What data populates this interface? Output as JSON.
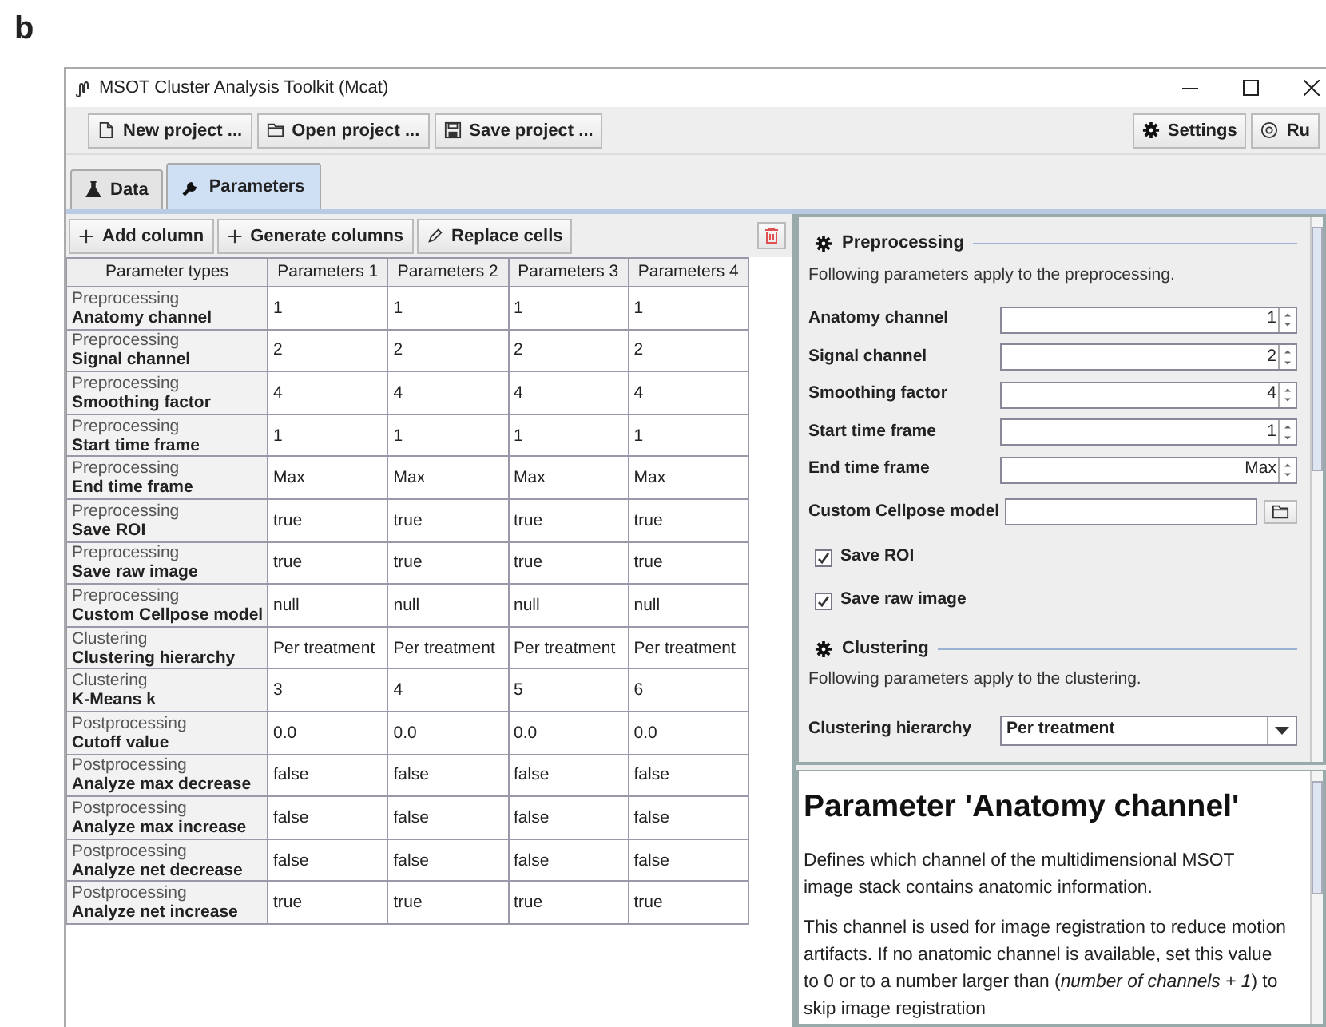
{
  "figure_label": "b",
  "window": {
    "title": "MSOT Cluster Analysis Toolkit (Mcat)"
  },
  "toolbar": {
    "left": [
      "New project ...",
      "Open project ...",
      "Save project ..."
    ],
    "right": [
      "Settings",
      "Ru"
    ]
  },
  "tabs": [
    {
      "label": "Data",
      "selected": false
    },
    {
      "label": "Parameters",
      "selected": true
    }
  ],
  "table_toolbar": [
    "Add column",
    "Generate columns",
    "Replace cells"
  ],
  "table": {
    "columns": [
      "Parameter types",
      "Parameters 1",
      "Parameters 2",
      "Parameters 3",
      "Parameters 4"
    ],
    "rows": [
      {
        "group": "Preprocessing",
        "name": "Anatomy channel",
        "values": [
          "1",
          "1",
          "1",
          "1"
        ]
      },
      {
        "group": "Preprocessing",
        "name": "Signal channel",
        "values": [
          "2",
          "2",
          "2",
          "2"
        ]
      },
      {
        "group": "Preprocessing",
        "name": "Smoothing factor",
        "values": [
          "4",
          "4",
          "4",
          "4"
        ]
      },
      {
        "group": "Preprocessing",
        "name": "Start time frame",
        "values": [
          "1",
          "1",
          "1",
          "1"
        ]
      },
      {
        "group": "Preprocessing",
        "name": "End time frame",
        "values": [
          "Max",
          "Max",
          "Max",
          "Max"
        ]
      },
      {
        "group": "Preprocessing",
        "name": "Save ROI",
        "values": [
          "true",
          "true",
          "true",
          "true"
        ]
      },
      {
        "group": "Preprocessing",
        "name": "Save raw image",
        "values": [
          "true",
          "true",
          "true",
          "true"
        ]
      },
      {
        "group": "Preprocessing",
        "name": "Custom Cellpose model",
        "values": [
          "null",
          "null",
          "null",
          "null"
        ]
      },
      {
        "group": "Clustering",
        "name": "Clustering hierarchy",
        "values": [
          "Per treatment",
          "Per treatment",
          "Per treatment",
          "Per treatment"
        ]
      },
      {
        "group": "Clustering",
        "name": "K-Means k",
        "values": [
          "3",
          "4",
          "5",
          "6"
        ]
      },
      {
        "group": "Postprocessing",
        "name": "Cutoff value",
        "values": [
          "0.0",
          "0.0",
          "0.0",
          "0.0"
        ]
      },
      {
        "group": "Postprocessing",
        "name": "Analyze max decrease",
        "values": [
          "false",
          "false",
          "false",
          "false"
        ]
      },
      {
        "group": "Postprocessing",
        "name": "Analyze max increase",
        "values": [
          "false",
          "false",
          "false",
          "false"
        ]
      },
      {
        "group": "Postprocessing",
        "name": "Analyze net decrease",
        "values": [
          "false",
          "false",
          "false",
          "false"
        ]
      },
      {
        "group": "Postprocessing",
        "name": "Analyze net increase",
        "values": [
          "true",
          "true",
          "true",
          "true"
        ]
      }
    ]
  },
  "form": {
    "sections": [
      {
        "title": "Preprocessing",
        "description": "Following parameters apply to the preprocessing.",
        "fields": [
          {
            "kind": "spinner",
            "label": "Anatomy channel",
            "value": "1"
          },
          {
            "kind": "spinner",
            "label": "Signal channel",
            "value": "2"
          },
          {
            "kind": "spinner",
            "label": "Smoothing factor",
            "value": "4"
          },
          {
            "kind": "spinner",
            "label": "Start time frame",
            "value": "1"
          },
          {
            "kind": "spinner",
            "label": "End time frame",
            "value": "Max"
          },
          {
            "kind": "file",
            "label": "Custom Cellpose model"
          },
          {
            "kind": "checkbox",
            "label": "Save ROI",
            "checked": true
          },
          {
            "kind": "checkbox",
            "label": "Save raw image",
            "checked": true
          }
        ]
      },
      {
        "title": "Clustering",
        "description": "Following parameters apply to the clustering.",
        "fields": [
          {
            "kind": "dropdown",
            "label": "Clustering hierarchy",
            "value": "Per treatment"
          }
        ]
      }
    ]
  },
  "help": {
    "heading": "Parameter 'Anatomy channel'",
    "paragraphs": [
      "Defines which channel of the multidimensional MSOT image stack contains anatomic information.",
      "This channel is used for image registration to reduce motion artifacts. If no anatomic channel is available, set this value to 0 or to a number larger than (*number of channels + 1*) to skip image registration"
    ]
  }
}
